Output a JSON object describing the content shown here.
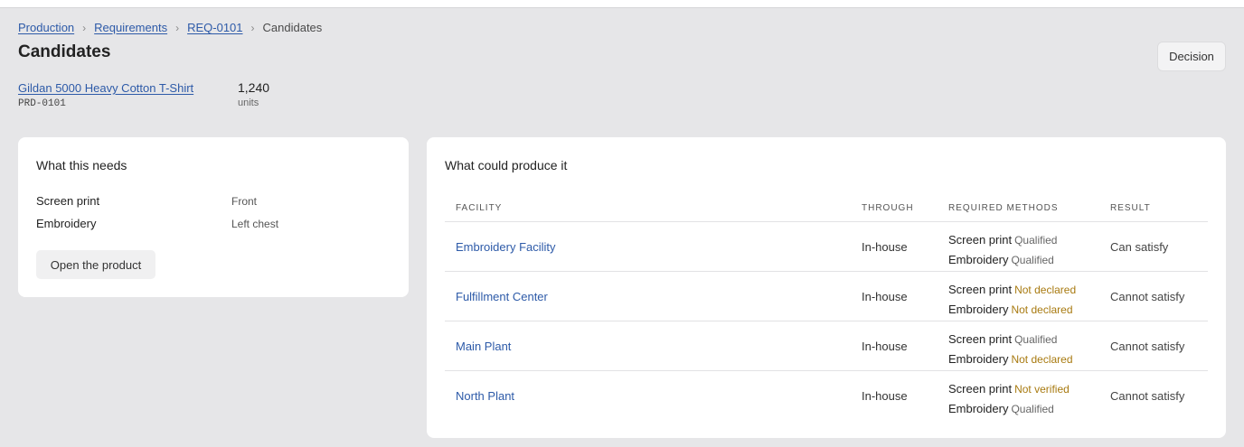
{
  "breadcrumb": [
    {
      "label": "Production"
    },
    {
      "label": "Requirements"
    },
    {
      "label": "REQ-0101"
    }
  ],
  "breadcrumb_current": "Candidates",
  "page_title": "Candidates",
  "decision_button": "Decision",
  "product": {
    "name": "Gildan 5000 Heavy Cotton T-Shirt",
    "code": "PRD-0101",
    "quantity": "1,240",
    "unit": "units"
  },
  "needs": {
    "title": "What this needs",
    "items": [
      {
        "method": "Screen print",
        "location": "Front"
      },
      {
        "method": "Embroidery",
        "location": "Left chest"
      }
    ],
    "open_button": "Open the product"
  },
  "candidates": {
    "title": "What could produce it",
    "columns": {
      "facility": "FACILITY",
      "through": "THROUGH",
      "methods": "REQUIRED METHODS",
      "result": "RESULT"
    },
    "rows": [
      {
        "facility": "Embroidery Facility",
        "through": "In-house",
        "methods": [
          {
            "name": "Screen print",
            "status": "Qualified",
            "tone": "ok"
          },
          {
            "name": "Embroidery",
            "status": "Qualified",
            "tone": "ok"
          }
        ],
        "result": "Can satisfy"
      },
      {
        "facility": "Fulfillment Center",
        "through": "In-house",
        "methods": [
          {
            "name": "Screen print",
            "status": "Not declared",
            "tone": "warn"
          },
          {
            "name": "Embroidery",
            "status": "Not declared",
            "tone": "warn"
          }
        ],
        "result": "Cannot satisfy"
      },
      {
        "facility": "Main Plant",
        "through": "In-house",
        "methods": [
          {
            "name": "Screen print",
            "status": "Qualified",
            "tone": "ok"
          },
          {
            "name": "Embroidery",
            "status": "Not declared",
            "tone": "warn"
          }
        ],
        "result": "Cannot satisfy"
      },
      {
        "facility": "North Plant",
        "through": "In-house",
        "methods": [
          {
            "name": "Screen print",
            "status": "Not verified",
            "tone": "warn"
          },
          {
            "name": "Embroidery",
            "status": "Qualified",
            "tone": "ok"
          }
        ],
        "result": "Cannot satisfy"
      }
    ]
  },
  "colors": {
    "link": "#2d5aa8",
    "warning": "#a87a10",
    "background": "#e6e6e8",
    "card": "#ffffff"
  }
}
